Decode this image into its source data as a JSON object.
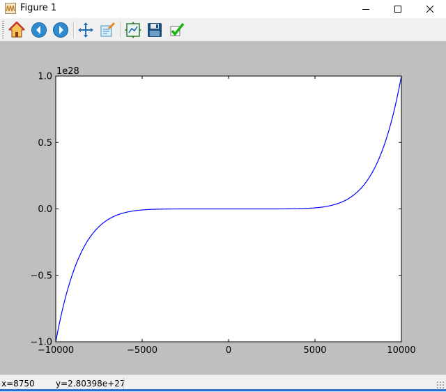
{
  "window": {
    "title": "Figure 1"
  },
  "toolbar": {
    "buttons": [
      {
        "name": "home-icon"
      },
      {
        "name": "back-icon"
      },
      {
        "name": "forward-icon"
      },
      {
        "name": "pan-icon"
      },
      {
        "name": "zoom-icon"
      },
      {
        "name": "subplots-icon"
      },
      {
        "name": "save-icon"
      },
      {
        "name": "edit-check-icon"
      }
    ]
  },
  "chart_data": {
    "type": "line",
    "title": "",
    "xlabel": "",
    "ylabel": "",
    "xlim": [
      -10000,
      10000
    ],
    "ylim": [
      -1.0,
      1.0
    ],
    "y_scale_label": "1e28",
    "xticks": [
      -10000,
      -5000,
      0,
      5000,
      10000
    ],
    "xtick_labels": [
      "−10000",
      "−5000",
      "0",
      "5000",
      "10000"
    ],
    "yticks": [
      -1.0,
      -0.5,
      0.0,
      0.5,
      1.0
    ],
    "ytick_labels": [
      "−1.0",
      "−0.5",
      "0.0",
      "0.5",
      "1.0"
    ],
    "series": [
      {
        "color": "#0000ff",
        "x": [
          -10000,
          -9500,
          -9000,
          -8500,
          -8000,
          -7500,
          -7000,
          -6500,
          -6000,
          -5500,
          -5000,
          -4000,
          -3000,
          -2000,
          -1000,
          0,
          1000,
          2000,
          3000,
          4000,
          5000,
          5500,
          6000,
          6500,
          7000,
          7500,
          8000,
          8500,
          8750,
          9000,
          9500,
          10000
        ],
        "y": [
          -1.0,
          -0.63,
          -0.387,
          -0.229,
          -0.134,
          -0.075,
          -0.04,
          -0.021,
          -0.01,
          -0.0047,
          -0.002,
          -0.0003,
          -2e-05,
          0,
          0,
          0,
          0,
          0,
          2e-05,
          0.0003,
          0.002,
          0.0047,
          0.01,
          0.021,
          0.04,
          0.075,
          0.134,
          0.229,
          0.28,
          0.387,
          0.63,
          1.0
        ]
      }
    ],
    "grid": false,
    "legend": "none"
  },
  "status": {
    "x_text": "x=8750",
    "y_text": "y=2.80398e+27"
  }
}
